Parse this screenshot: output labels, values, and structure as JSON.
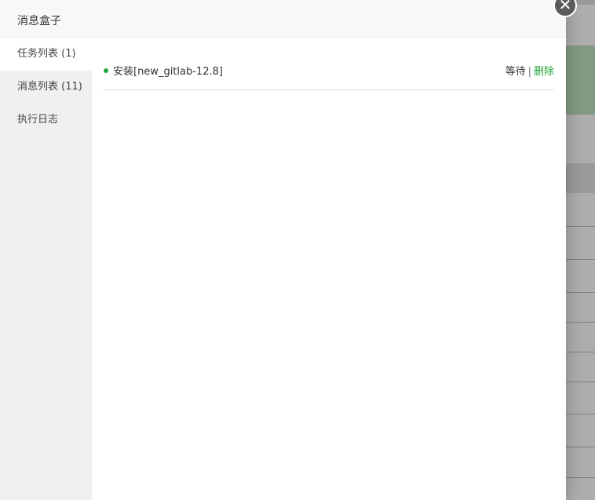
{
  "modal": {
    "title": "消息盒子",
    "close_glyph": "✕"
  },
  "sidebar": {
    "items": [
      {
        "label": "任务列表 (1)",
        "active": true
      },
      {
        "label": "消息列表 (11)",
        "active": false
      },
      {
        "label": "执行日志",
        "active": false
      }
    ]
  },
  "tasks": [
    {
      "name": "安装[new_gitlab-12.8]",
      "status": "等待",
      "separator": "|",
      "delete_label": "删除",
      "dot_icon": "status-dot-icon"
    }
  ],
  "colors": {
    "accent": "#20a53a",
    "sidebar_bg": "#f0f0f0",
    "header_bg": "#f8f8f8"
  }
}
